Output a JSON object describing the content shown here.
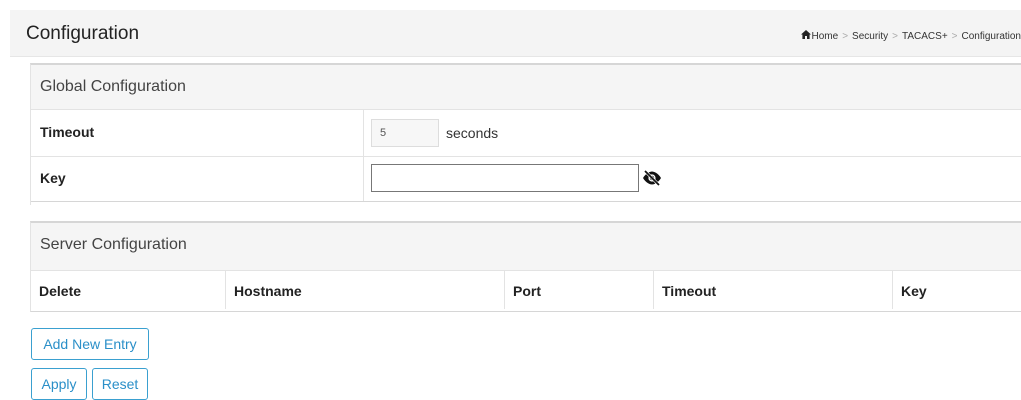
{
  "header": {
    "title": "Configuration",
    "breadcrumb": [
      "Home",
      "Security",
      "TACACS+",
      "Configuration"
    ],
    "breadcrumb_separator": ">"
  },
  "global_config": {
    "title": "Global Configuration",
    "timeout": {
      "label": "Timeout",
      "value": "5",
      "unit": "seconds"
    },
    "key": {
      "label": "Key",
      "value": "",
      "toggle_icon": "eye-slash-icon"
    }
  },
  "server_config": {
    "title": "Server Configuration",
    "columns": [
      "Delete",
      "Hostname",
      "Port",
      "Timeout",
      "Key"
    ],
    "rows": []
  },
  "buttons": {
    "add_new_entry": "Add New Entry",
    "apply": "Apply",
    "reset": "Reset"
  },
  "colors": {
    "button_accent": "#2a8fc8",
    "header_bg": "#f4f4f4"
  }
}
